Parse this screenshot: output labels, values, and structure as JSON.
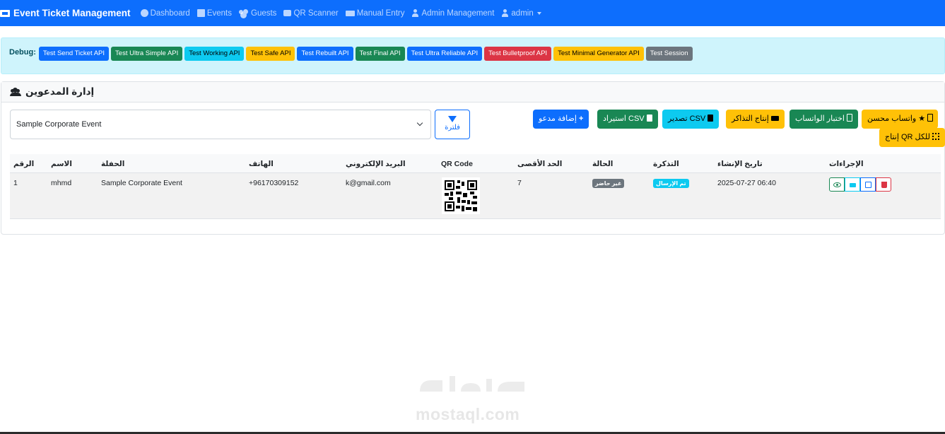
{
  "navbar": {
    "brand": "Event Ticket Management",
    "links": [
      "Dashboard",
      "Events",
      "Guests",
      "QR Scanner",
      "Manual Entry",
      "Admin Management",
      "admin"
    ]
  },
  "debug": {
    "label": "Debug:",
    "buttons": [
      "Test Send Ticket API",
      "Test Ultra Simple API",
      "Test Working API",
      "Test Safe API",
      "Test Rebuilt API",
      "Test Final API",
      "Test Ultra Reliable API",
      "Test Bulletproof API",
      "Test Minimal Generator API",
      "Test Session"
    ]
  },
  "card": {
    "title": "إدارة المدعوين",
    "event_select": "Sample Corporate Event",
    "filter_label": "فلترة",
    "actions": {
      "add_guest": "إضافة مدعو",
      "import_csv": "استيراد CSV",
      "export_csv": "تصدير CSV",
      "generate_tickets": "إنتاج التذاكر",
      "test_whatsapp": "اختبار الواتساب",
      "whatsapp_enhanced": "واتساب محسن",
      "generate_qr_all": "إنتاج QR للكل"
    }
  },
  "table": {
    "headers": {
      "num": "الرقم",
      "name": "الاسم",
      "event": "الحفلة",
      "phone": "الهاتف",
      "email": "البريد الإلكتروني",
      "qr": "QR Code",
      "max": "الحد الأقصى",
      "status": "الحالة",
      "ticket": "التذكرة",
      "created": "تاريخ الإنشاء",
      "actions": "الإجراءات"
    },
    "rows": [
      {
        "num": "1",
        "name": "mhmd",
        "event": "Sample Corporate Event",
        "phone": "+96170309152",
        "email": "k@gmail.com",
        "max": "7",
        "status": "غير حاضر",
        "ticket": "تم الإرسال",
        "created": "2025-07-27 06:40"
      }
    ]
  },
  "watermark": "mostaql.com",
  "colors": {
    "primary": "#0d6efd",
    "success": "#198754",
    "info": "#0dcaf0",
    "warning": "#ffc107",
    "danger": "#dc3545",
    "secondary": "#6c757d"
  }
}
